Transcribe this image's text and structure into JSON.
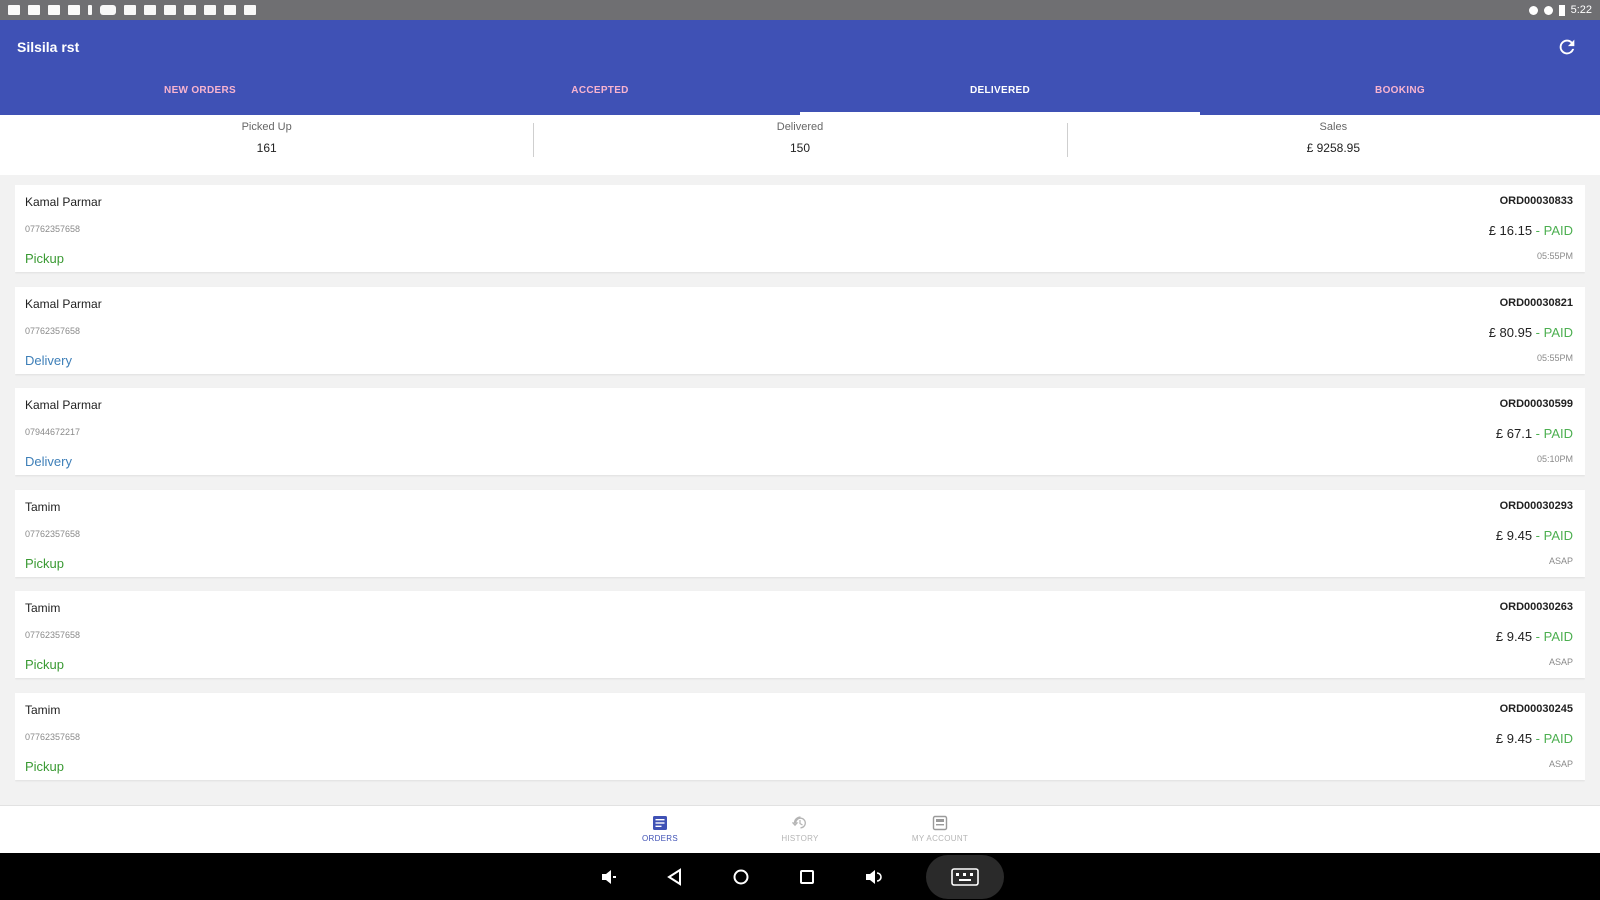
{
  "app": {
    "title": "Silsila rst"
  },
  "tabs": [
    {
      "label": "NEW ORDERS"
    },
    {
      "label": "ACCEPTED"
    },
    {
      "label": "DELIVERED"
    },
    {
      "label": "BOOKING"
    }
  ],
  "active_tab": "DELIVERED",
  "stats": [
    {
      "label": "Picked Up",
      "value": "161"
    },
    {
      "label": "Delivered",
      "value": "150"
    },
    {
      "label": "Sales",
      "value": "£ 9258.95"
    }
  ],
  "orders": [
    {
      "name": "Kamal Parmar",
      "phone": "07762357658",
      "type": "Pickup",
      "order_no": "ORD00030833",
      "amount": "£ 16.15",
      "status": " - PAID",
      "time": "05:55PM"
    },
    {
      "name": "Kamal Parmar",
      "phone": "07762357658",
      "type": "Delivery",
      "order_no": "ORD00030821",
      "amount": "£ 80.95",
      "status": " - PAID",
      "time": "05:55PM"
    },
    {
      "name": "Kamal Parmar",
      "phone": "07944672217",
      "type": "Delivery",
      "order_no": "ORD00030599",
      "amount": "£ 67.1",
      "status": " - PAID",
      "time": "05:10PM"
    },
    {
      "name": "Tamim",
      "phone": "07762357658",
      "type": "Pickup",
      "order_no": "ORD00030293",
      "amount": "£ 9.45",
      "status": " - PAID",
      "time": "ASAP"
    },
    {
      "name": "Tamim",
      "phone": "07762357658",
      "type": "Pickup",
      "order_no": "ORD00030263",
      "amount": "£ 9.45",
      "status": " - PAID",
      "time": "ASAP"
    },
    {
      "name": "Tamim",
      "phone": "07762357658",
      "type": "Pickup",
      "order_no": "ORD00030245",
      "amount": "£ 9.45",
      "status": " - PAID",
      "time": "ASAP"
    }
  ],
  "bottom_nav": [
    {
      "label": "ORDERS",
      "icon": "orders-icon"
    },
    {
      "label": "HISTORY",
      "icon": "history-icon"
    },
    {
      "label": "MY ACCOUNT",
      "icon": "account-icon"
    }
  ],
  "status_bar": {
    "time": "5:22"
  },
  "colors": {
    "primary": "#3f51b5",
    "paid": "#4caf50",
    "pickup": "#3a9a33",
    "delivery": "#3e7fb8",
    "tab_inactive": "#f8b4d0"
  }
}
